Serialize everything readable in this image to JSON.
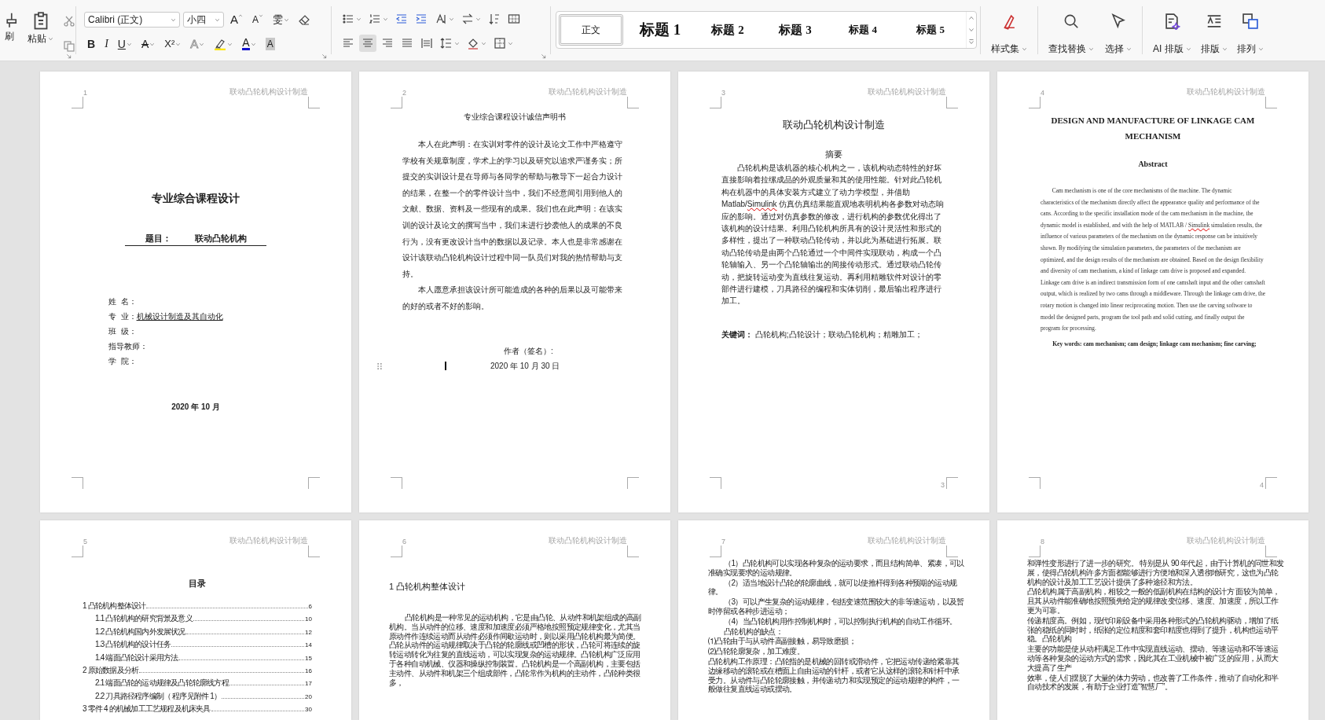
{
  "ribbon": {
    "clipboard": {
      "format_painter": "刷",
      "paste": "粘贴"
    },
    "font": {
      "name": "Calibri (正文)",
      "size": "小四"
    },
    "font_tools": [
      {
        "kind": "grow",
        "glyph": "A"
      },
      {
        "kind": "shrink",
        "glyph": "A"
      },
      {
        "kind": "phonetic",
        "glyph": "雯",
        "dropdown": true
      }
    ],
    "font_buttons": [
      {
        "kind": "bold",
        "glyph": "B",
        "dropdown": false
      },
      {
        "kind": "italic",
        "glyph": "I",
        "dropdown": false
      },
      {
        "kind": "underline",
        "glyph": "U",
        "dropdown": true
      },
      {
        "kind": "strike",
        "glyph": "A",
        "dropdown": true
      },
      {
        "kind": "superscript",
        "glyph": "X²",
        "dropdown": true
      },
      {
        "kind": "effects",
        "glyph": "A",
        "dropdown": true
      },
      {
        "kind": "highlight",
        "dropdown": true
      },
      {
        "kind": "font_color",
        "glyph": "A",
        "dropdown": true
      },
      {
        "kind": "shading",
        "glyph": "A",
        "dropdown": false
      }
    ],
    "paragraph_buttons": [
      {
        "kind": "bullets",
        "dropdown": true,
        "selected": false
      },
      {
        "kind": "numbering",
        "dropdown": true,
        "selected": false
      },
      {
        "kind": "outdent",
        "dropdown": false,
        "selected": false
      },
      {
        "kind": "indent",
        "dropdown": false,
        "selected": false
      },
      {
        "kind": "direction",
        "dropdown": true,
        "selected": false
      },
      {
        "kind": "swap",
        "dropdown": true,
        "selected": false
      },
      {
        "kind": "sort",
        "dropdown": false,
        "selected": false
      },
      {
        "kind": "grid",
        "dropdown": false,
        "selected": false
      },
      {
        "kind": "align_left",
        "dropdown": false,
        "selected": false
      },
      {
        "kind": "align_center",
        "dropdown": false,
        "selected": true
      },
      {
        "kind": "align_right",
        "dropdown": false,
        "selected": false
      },
      {
        "kind": "justify",
        "dropdown": false,
        "selected": false
      },
      {
        "kind": "distribute",
        "dropdown": false,
        "selected": false
      },
      {
        "kind": "line_spacing",
        "dropdown": true,
        "selected": false
      },
      {
        "kind": "fill",
        "dropdown": true,
        "selected": false
      },
      {
        "kind": "borders",
        "dropdown": true,
        "selected": false
      }
    ],
    "styles": [
      {
        "label": "正文",
        "kind": "body",
        "selected": true
      },
      {
        "label": "标题 1",
        "kind": "h1",
        "selected": false
      },
      {
        "label": "标题 2",
        "kind": "h2",
        "selected": false
      },
      {
        "label": "标题 3",
        "kind": "h3",
        "selected": false
      },
      {
        "label": "标题 4",
        "kind": "h4",
        "selected": false
      },
      {
        "label": "标题 5",
        "kind": "h5",
        "selected": false
      }
    ],
    "tool_groups": [
      [
        {
          "label": "样式集",
          "kind": "style_set"
        }
      ],
      [
        {
          "label": "查找替换",
          "kind": "find"
        },
        {
          "label": "选择",
          "kind": "select"
        }
      ],
      [
        {
          "label": "AI 排版",
          "kind": "ai"
        },
        {
          "label": "排版",
          "kind": "layout"
        },
        {
          "label": "排列",
          "kind": "arrange"
        }
      ]
    ]
  },
  "pages": [
    {
      "kind": "cover",
      "number": "1",
      "header": "联动凸轮机构设计制造",
      "title": "专业综合课程设计",
      "topic_label": "题目：",
      "topic": "联动凸轮机构",
      "fields": [
        {
          "label": "姓  名："
        },
        {
          "label": "专  业：",
          "value": "机械设计制造及其自动化"
        },
        {
          "label": "班  级："
        },
        {
          "label": "指导教师："
        },
        {
          "label": "学  院："
        }
      ],
      "date": "2020 年 10 月"
    },
    {
      "kind": "declaration",
      "number": "2",
      "header": "联动凸轮机构设计制造",
      "title": "专业综合课程设计诚信声明书",
      "paragraphs": [
        "本人在此声明：在实训对零件的设计及论文工作中严格遵守学校有关规章制度，学术上的学习以及研究以追求严谨务实；所提交的实训设计是在导师与各同学的帮助与教导下一起合力设计的结果，在整一个的零件设计当中，我们不经意间引用到他人的文献、数据、资料及一些现有的成果。我们也在此声明：在该实训的设计及论文的撰写当中，我们未进行抄袭他人的成果的不良行为，没有更改设计当中的数据以及记录。本人也是非常感谢在设计该联动凸轮机构设计过程中同一队员们对我的热情帮助与支持。",
        "本人愿意承担该设计所可能造成的各种的后果以及可能带来的好的或者不好的影响。"
      ],
      "signature": "作者（签名）:",
      "date": "2020 年 10 月 30 日"
    },
    {
      "kind": "abstract_cn",
      "number": "3",
      "header": "联动凸轮机构设计制造",
      "title": "联动凸轮机构设计制造",
      "heading": "摘要",
      "segments": [
        {
          "text": "凸轮机构是该机器的核心机构之一，该机构动态特性的好坏直接影响着拉缧成品的外观质量和其的使用性能。针对此凸轮机构在机器中的具体安装方式建立了动力学模型，并借助 Matlab/",
          "misspelled": false
        },
        {
          "text": "Simulink",
          "misspelled": true
        },
        {
          "text": " 仿真仿真结果能直观地表明机构各参数对动态响应的影响。通过对仿真参数的修改，进行机构的参数优化得出了该机构的设计结果。利用凸轮机构所具有的设计灵活性和形式的多样性，提出了一种联动凸轮传动，并以此为基础进行拓展。联动凸轮传动是由两个凸轮通过一个中间件实现联动，构成一个凸轮轴输入、另一个凸轮轴输出的间接传动形式。通过联动凸轮传动，把旋转运动变为直线往复运动。再利用精雕软件对设计的零部件进行建模，刀具路径的编程和实体切削，最后输出程序进行加工。",
          "misspelled": false
        }
      ],
      "keywords": "**关键词：** 凸轮机构;凸轮设计；联动凸轮机构；精雕加工；",
      "footer_number": "3"
    },
    {
      "kind": "abstract_en",
      "number": "4",
      "header": "联动凸轮机构设计制造",
      "title": "DESIGN AND MANUFACTURE OF LINKAGE CAM MECHANISM",
      "heading": "Abstract",
      "segments": [
        {
          "text": "Cam mechanism is one of the core mechanisms of the machine. The dynamic characteristics of the mechanism directly affect the appearance quality and performance of the cans. According to the specific installation mode of the cam mechanism in the machine, the dynamic model is established, and with the help of MATLAB / ",
          "misspelled": false
        },
        {
          "text": "Simulink",
          "misspelled": true
        },
        {
          "text": " simulation results, the influence of various parameters of the mechanism on the dynamic response can be intuitively shown. By modifying the simulation parameters, the parameters of the mechanism are optimized, and the design results of the mechanism are obtained. Based on the design flexibility and diversity of cam mechanism, a kind of linkage cam drive is proposed and expanded. Linkage cam drive is an indirect transmission form of one camshaft input and the other camshaft output, which is realized by two cams through a middleware. Through the linkage cam drive, the rotary motion is changed into linear reciprocating motion. Then use the carving software to model the designed parts, program the tool path and solid cutting, and finally output the program for processing.",
          "misspelled": false
        }
      ],
      "keywords": "Key words: cam mechanism; cam design; linkage cam mechanism; fine carving;",
      "footer_number": "4"
    },
    {
      "kind": "toc",
      "number": "5",
      "header": "联动凸轮机构设计制造",
      "heading": "目录",
      "entries": [
        {
          "text": "1 凸轮机构整体设计",
          "page": "6",
          "children": [
            {
              "text": "1.1 凸轮机构的研究背景及意义",
              "page": "10"
            },
            {
              "text": "1.2 凸轮机构国内外发展状况",
              "page": "12"
            },
            {
              "text": "1.3 凸轮机构的设计任务",
              "page": "14"
            },
            {
              "text": "1.4 端面凸轮设计采用方法",
              "page": "15"
            }
          ]
        },
        {
          "text": "2 原始数据及分析",
          "page": "16",
          "children": [
            {
              "text": "2.1 端面凸轮的运动规律及凸轮轮廓线方程",
              "page": "17"
            },
            {
              "text": "2.2 刀具路径程序编制（ 程序见附件 1）",
              "page": "20"
            }
          ]
        },
        {
          "text": "3 零件 4 的机械加工工艺规程及机床夹具",
          "page": "30"
        }
      ]
    },
    {
      "kind": "chapter",
      "number": "6",
      "header": "联动凸轮机构设计制造",
      "heading": "1 凸轮机构整体设计",
      "paragraphs": [
        {
          "text": "凸轮机构是一种常见的运动机构，它是由凸轮、从动件和机架组成的高副机构。当从动件的位移、速度和加速度必须严格地按照预定规律变化，尤其当原动件作连续运动而从动件必须作间歇运动时，则以采用凸轮机构最为简便。凸轮从动件的运动规律取决于凸轮的轮廓线或凹槽的形状，凸轮可将连续的旋转运动转化为往复的直线运动，可以实现复杂的运动规律。凸轮机构广泛应用于各种自动机械、仪器和操纵控制装置。凸轮机构是一个高副机构，主要包括主动件、从动件和机架三个组成部件，凸轮常作为机构的主动件，凸轮种类很多，",
          "indent": true
        }
      ]
    },
    {
      "kind": "text",
      "number": "7",
      "header": "联动凸轮机构设计制造",
      "paragraphs": [
        {
          "text": "（1）凸轮机构可以实现各种复杂的运动要求，而且结构简单、紧凑，可以准确实现要求的运动规律。",
          "indent": true
        },
        {
          "text": "（2）适当地设计凸轮的轮廓曲线，就可以使推杆得到各种预期的运动规律。",
          "indent": true
        },
        {
          "text": "（3）可以产生复杂的运动规律，包括变速范围较大的非等速运动，以及暂时停留或各种步进运动；",
          "indent": true
        },
        {
          "text": "（4）当凸轮机构用作控制机构时，可以控制执行机构的自动工作循环。",
          "indent": true
        },
        {
          "text": "凸轮机构的缺点：",
          "indent": true
        },
        {
          "text": "⑴凸轮由于与从动件高副接触，易导致磨损；",
          "indent": false
        },
        {
          "text": "⑵凸轮轮廓复杂，加工难度。",
          "indent": false
        },
        {
          "text": "凸轮机构工作原理：凸轮指的是机械的回转或滑动件，它把运动传递给紧靠其边缘移动的滚轮或在槽面上自由运动的针杆，或者它从这样的滚轮和针杆中承受力。从动件与凸轮轮廓接触，并传递动力和实现预定的运动规律的构件，一般做往复直线运动或摆动。",
          "indent": false
        }
      ]
    },
    {
      "kind": "text",
      "number": "8",
      "header": "联动凸轮机构设计制造",
      "paragraphs": [
        {
          "text": "和弹性变形进行了进一步的研究。 特别是从 90 年代起，由于计算机的问世和发展，使得凸轮机构许多方面都能够进行方便地和深入透彻地研究，这也为凸轮机构的设计及加工工艺设计提供了多种途径和方法。",
          "indent": false
        },
        {
          "text": "凸轮机构属于高副机构，相较之一般的低副机构在结构的设计方 面较为简单，且其从动件能准确地按照预先给定的规律改变位移、速度、加速度，所以工作更为可靠。",
          "indent": false
        },
        {
          "text": "传递精度高。例如，现代印刷设备中采用各种形式的凸轮机构驱动，增加了纸张的稳纸的同时时，纸张的定位精度和套印精度也得到了提升，机构也运动平稳。凸轮机构",
          "indent": false
        },
        {
          "text": "主要的功能是使从动杆满足工作中实现直线运动、摆动、等速运动和不等速运动等各种复杂的运动方式的需求，因此其在工业机械中被广泛的应用，从而大大提高了生产",
          "indent": false
        },
        {
          "text": "效率，使人们摆脱了大量的体力劳动，也改善了工作条件，推动了自动化和半自动技术的发展，有助于企业打造“智慧厂”。",
          "indent": false
        }
      ]
    }
  ]
}
